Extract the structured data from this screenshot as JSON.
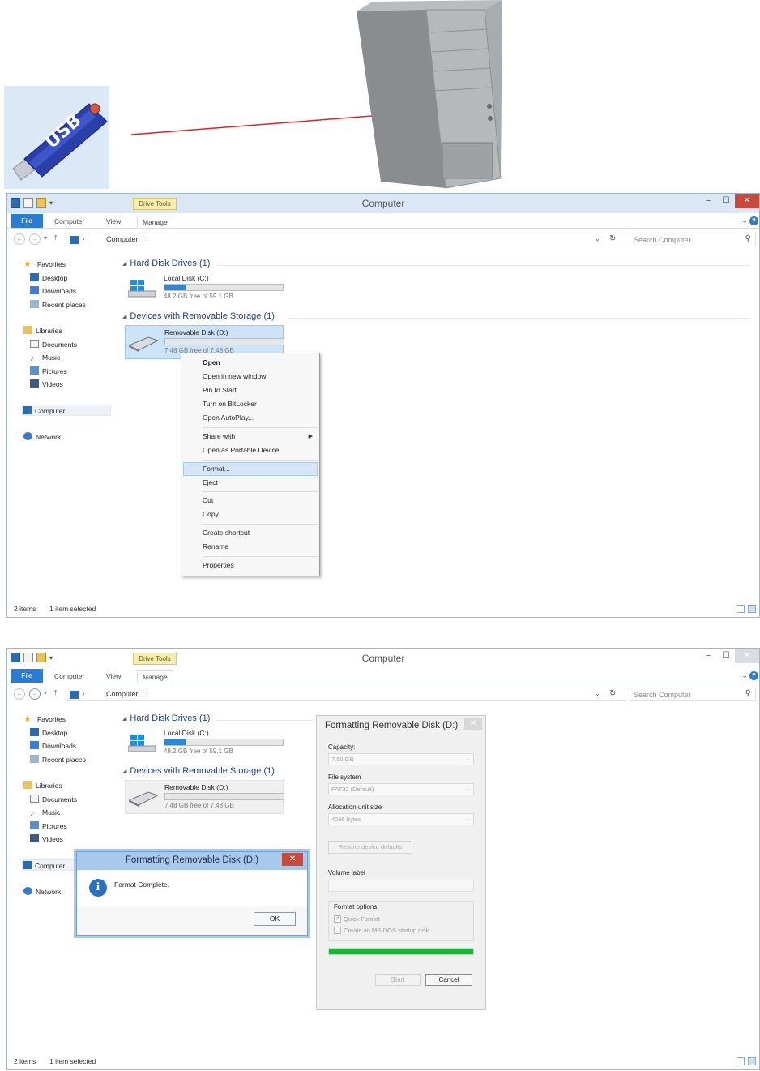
{
  "illustration": {
    "usb_text": "USB"
  },
  "window1": {
    "title": "Computer",
    "drive_tools": "Drive Tools",
    "tabs": {
      "file": "File",
      "computer": "Computer",
      "view": "View",
      "manage": "Manage"
    },
    "address": "Computer",
    "search_placeholder": "Search Computer",
    "nav": {
      "favorites": "Favorites",
      "desktop": "Desktop",
      "downloads": "Downloads",
      "recent": "Recent places",
      "libraries": "Libraries",
      "documents": "Documents",
      "music": "Music",
      "pictures": "Pictures",
      "videos": "Videos",
      "computer": "Computer",
      "network": "Network"
    },
    "groups": {
      "hdd": "Hard Disk Drives (1)",
      "removable": "Devices with Removable Storage (1)"
    },
    "drives": {
      "c_name": "Local Disk (C:)",
      "c_free": "48.2 GB free of 59.1 GB",
      "c_used_fraction": 0.18,
      "d_name": "Removable Disk (D:)",
      "d_free": "7.48 GB free of 7.48 GB",
      "d_used_fraction": 0
    },
    "context_menu": {
      "open": "Open",
      "open_new_window": "Open in new window",
      "pin_to_start": "Pin to Start",
      "bitlocker": "Turn on BitLocker",
      "autoplay": "Open AutoPlay...",
      "share_with": "Share with",
      "portable_device": "Open as Portable Device",
      "format": "Format...",
      "eject": "Eject",
      "cut": "Cut",
      "copy": "Copy",
      "create_shortcut": "Create shortcut",
      "rename": "Rename",
      "properties": "Properties"
    },
    "status": {
      "items": "2 items",
      "selected": "1 item selected"
    }
  },
  "window2": {
    "title": "Computer",
    "drive_tools": "Drive Tools",
    "tabs": {
      "file": "File",
      "computer": "Computer",
      "view": "View",
      "manage": "Manage"
    },
    "address": "Computer",
    "search_placeholder": "Search Computer",
    "nav": {
      "favorites": "Favorites",
      "desktop": "Desktop",
      "downloads": "Downloads",
      "recent": "Recent places",
      "libraries": "Libraries",
      "documents": "Documents",
      "music": "Music",
      "pictures": "Pictures",
      "videos": "Videos",
      "computer": "Computer",
      "network": "Network"
    },
    "groups": {
      "hdd": "Hard Disk Drives (1)",
      "removable": "Devices with Removable Storage (1)"
    },
    "drives": {
      "c_name": "Local Disk (C:)",
      "c_free": "48.2 GB free of 59.1 GB",
      "c_used_fraction": 0.18,
      "d_name": "Removable Disk (D:)",
      "d_free": "7.48 GB free of 7.48 GB",
      "d_used_fraction": 0
    },
    "format_dialog": {
      "title": "Formatting Removable Disk (D:)",
      "capacity_label": "Capacity:",
      "capacity_value": "7.50 GB",
      "filesystem_label": "File system",
      "filesystem_value": "FAT32 (Default)",
      "alloc_label": "Allocation unit size",
      "alloc_value": "4096 bytes",
      "restore_label": "Restore device defaults",
      "volume_label": "Volume label",
      "options_label": "Format options",
      "quick_format": "Quick Format",
      "quick_format_checked": true,
      "msdos_disk": "Create an MS-DOS startup disk",
      "msdos_checked": false,
      "progress_fraction": 1,
      "start_label": "Start",
      "cancel_label": "Cancel"
    },
    "complete_dialog": {
      "title": "Formatting Removable Disk (D:)",
      "message": "Format Complete.",
      "ok_label": "OK"
    },
    "status": {
      "items": "2 items",
      "selected": "1 item selected"
    }
  }
}
